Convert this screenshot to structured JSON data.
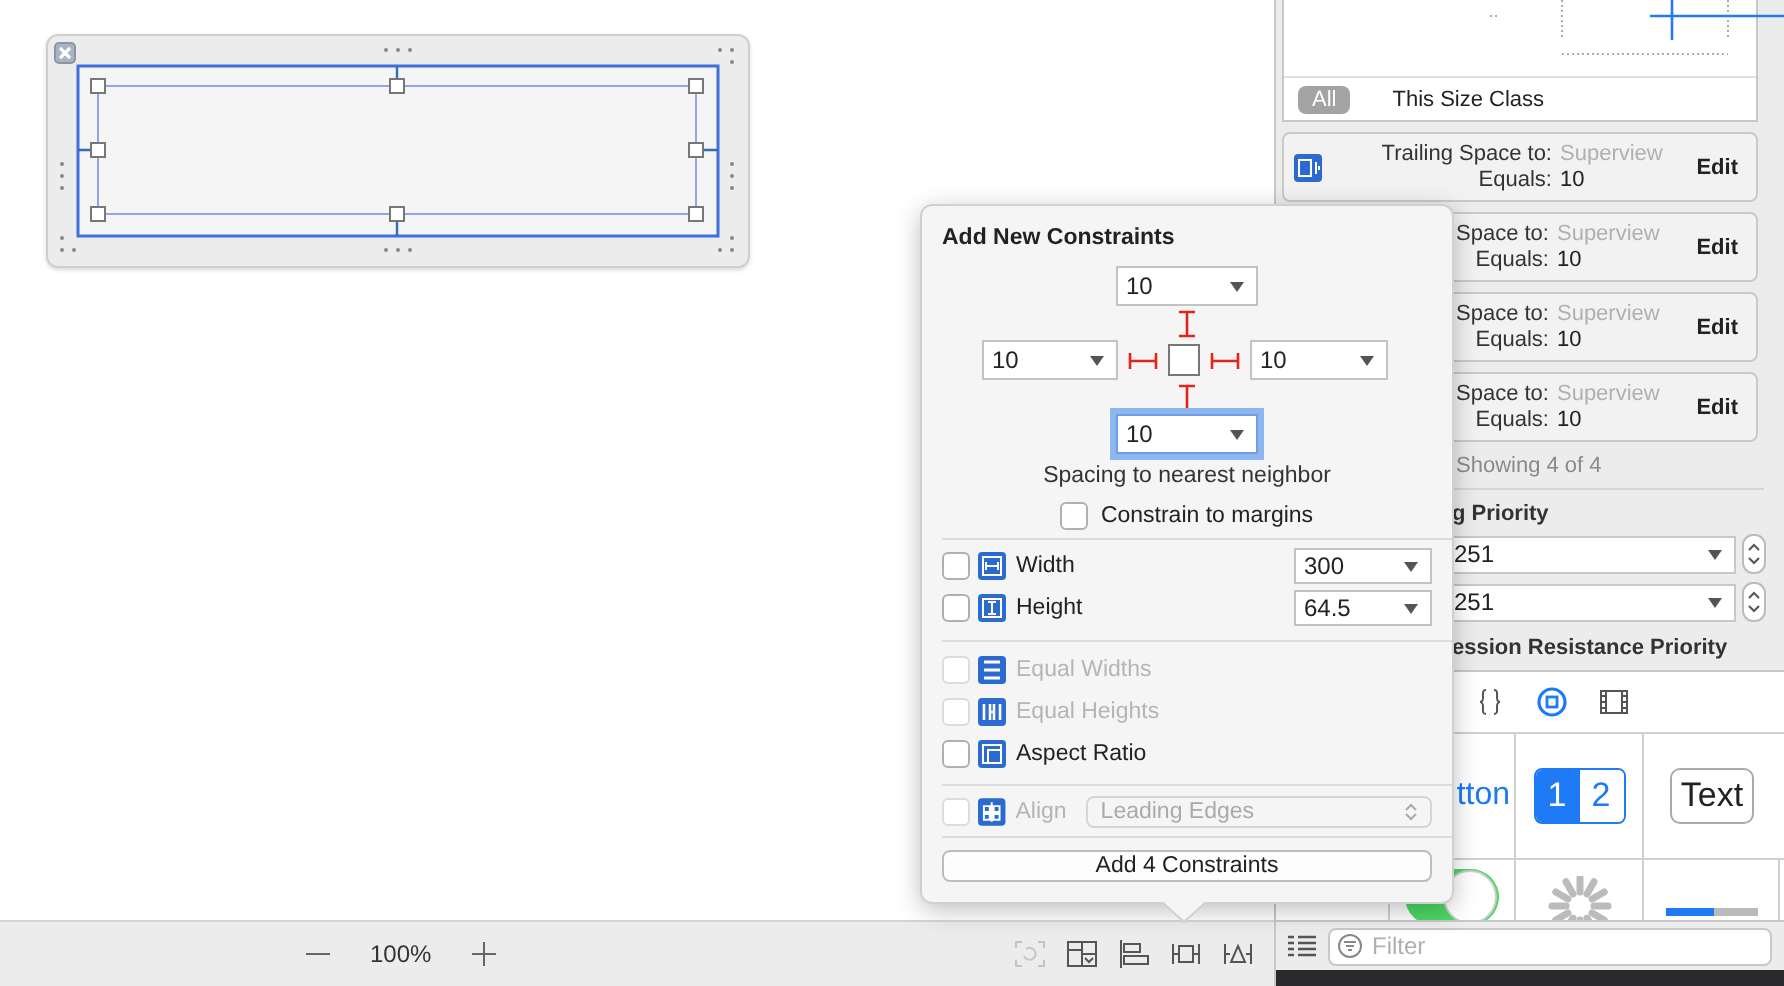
{
  "canvas": {
    "zoom": "100%",
    "tools": [
      {
        "kind": "update-frames",
        "disabled": true
      },
      {
        "kind": "stack",
        "disabled": false
      },
      {
        "kind": "align",
        "disabled": false
      },
      {
        "kind": "pin",
        "disabled": false
      },
      {
        "kind": "resolve",
        "disabled": false
      }
    ]
  },
  "popover": {
    "title": "Add New Constraints",
    "spacing": {
      "top": {
        "value": "10",
        "focused": false
      },
      "left": {
        "value": "10",
        "focused": false
      },
      "right": {
        "value": "10",
        "focused": false
      },
      "bottom": {
        "value": "10",
        "focused": true
      }
    },
    "caption": "Spacing to nearest neighbor",
    "margins": {
      "label": "Constrain to margins",
      "checked": false
    },
    "size": [
      {
        "kind": "width",
        "label": "Width",
        "checked": false,
        "disabled": false,
        "value": "300"
      },
      {
        "kind": "height",
        "label": "Height",
        "checked": false,
        "disabled": false,
        "value": "64.5"
      }
    ],
    "relations": [
      {
        "kind": "equal-widths",
        "label": "Equal Widths",
        "checked": false,
        "disabled": true
      },
      {
        "kind": "equal-heights",
        "label": "Equal Heights",
        "checked": false,
        "disabled": true
      },
      {
        "kind": "aspect-ratio",
        "label": "Aspect Ratio",
        "checked": false,
        "disabled": false
      }
    ],
    "align": {
      "label": "Align",
      "checked": false,
      "disabled": true,
      "option": "Leading Edges"
    },
    "button": "Add 4 Constraints"
  },
  "inspector": {
    "size_class_tabs": [
      {
        "label": "All",
        "selected": true
      },
      {
        "label": "This Size Class",
        "selected": false
      }
    ],
    "constraints": [
      {
        "kind": "full",
        "label": "Trailing Space to:",
        "target": "Superview",
        "equals_label": "Equals:",
        "value": "10",
        "action": "Edit"
      },
      {
        "kind": "partial",
        "label": "Space to:",
        "target": "Superview",
        "equals_label": "Equals:",
        "value": "10",
        "action": "Edit"
      },
      {
        "kind": "partial",
        "label": "Space to:",
        "target": "Superview",
        "equals_label": "Equals:",
        "value": "10",
        "action": "Edit"
      },
      {
        "kind": "partial",
        "label": "Space to:",
        "target": "Superview",
        "equals_label": "Equals:",
        "value": "10",
        "action": "Edit"
      }
    ],
    "showing": "Showing 4 of 4",
    "hugging": {
      "title": "g Priority",
      "rows": [
        {
          "value": "251"
        },
        {
          "value": "251"
        }
      ]
    },
    "compression": {
      "title": "ession Resistance Priority"
    }
  },
  "library": {
    "tabs": [
      {
        "kind": "code",
        "selected": false
      },
      {
        "kind": "object",
        "selected": true
      },
      {
        "kind": "media",
        "selected": false
      }
    ],
    "items": [
      {
        "kind": "button",
        "label": "tton"
      },
      {
        "kind": "segmented",
        "segments": [
          {
            "label": "1",
            "selected": true
          },
          {
            "label": "2",
            "selected": false
          }
        ]
      },
      {
        "kind": "text-button",
        "label": "Text"
      }
    ],
    "filter": {
      "placeholder": "Filter"
    }
  }
}
